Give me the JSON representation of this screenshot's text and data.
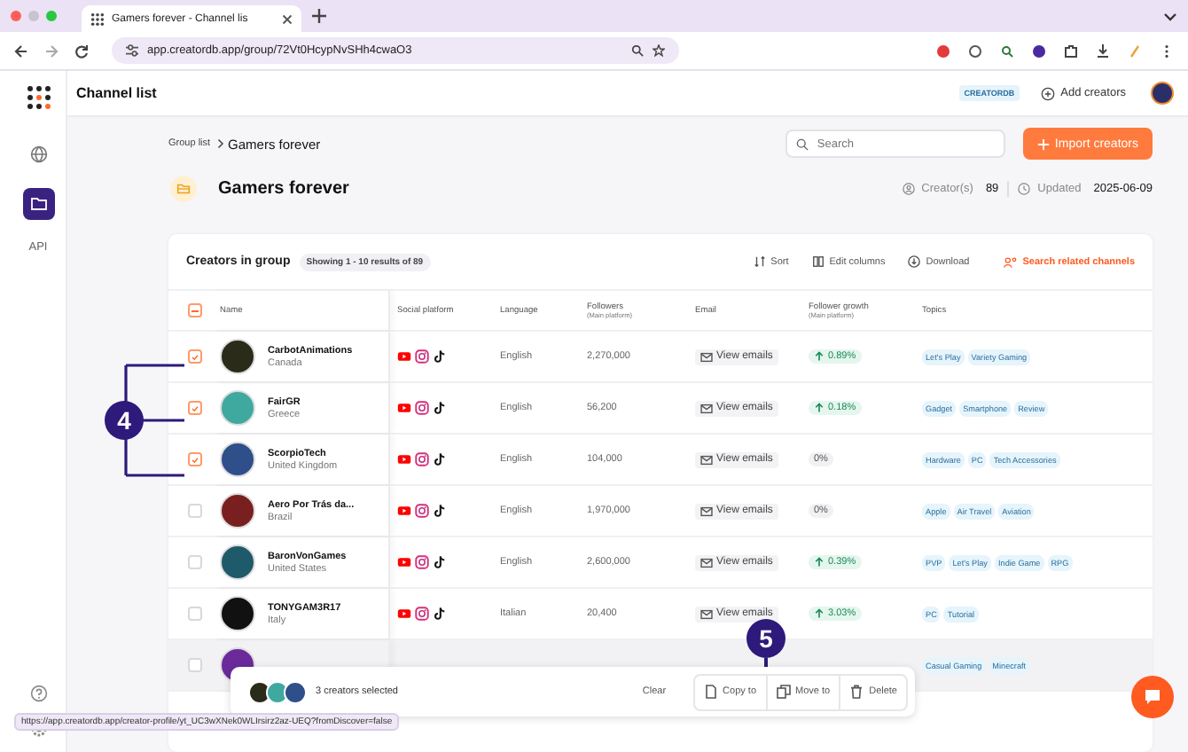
{
  "browser": {
    "tab_title": "Gamers forever - Channel lis",
    "url": "app.creatordb.app/group/72Vt0HcypNvSHh4cwaO3"
  },
  "sidebar": {
    "items": [
      {
        "kind": "globe",
        "selected": false
      },
      {
        "kind": "folder",
        "selected": true
      },
      {
        "kind": "api",
        "label": "API",
        "selected": false
      }
    ]
  },
  "header": {
    "title": "Channel list",
    "brand": "CREATORDB",
    "add_button": "Add creators"
  },
  "breadcrumb": [
    {
      "label": "Group list"
    },
    {
      "label": "Gamers forever"
    }
  ],
  "search": {
    "placeholder": "Search"
  },
  "import_button": "Import creators",
  "group": {
    "title": "Gamers forever",
    "creators_label": "Creator(s)",
    "creators_count": "89",
    "updated_label": "Updated",
    "updated_date": "2025-06-09"
  },
  "table": {
    "title": "Creators in group",
    "showing": "Showing 1 - 10 results of 89",
    "actions": [
      {
        "kind": "sort",
        "label": "Sort"
      },
      {
        "kind": "columns",
        "label": "Edit columns"
      },
      {
        "kind": "download",
        "label": "Download"
      },
      {
        "kind": "related",
        "label": "Search related channels"
      }
    ],
    "select_all_partial": true,
    "columns": [
      {
        "label": "Name"
      },
      {
        "label": "Social platform"
      },
      {
        "label": "Language"
      },
      {
        "label": "Followers",
        "sub": "(Main platform)"
      },
      {
        "label": "Email"
      },
      {
        "label": "Follower growth",
        "sub": "(Main platform)"
      },
      {
        "label": "Topics"
      }
    ],
    "rows": [
      {
        "name": "CarbotAnimations",
        "country": "Canada",
        "checked": true,
        "hovered": false,
        "platforms": [
          {
            "kind": "youtube"
          },
          {
            "kind": "instagram"
          },
          {
            "kind": "tiktok"
          }
        ],
        "language": "English",
        "followers": "2,270,000",
        "email": "View emails",
        "growth": "0.89%",
        "rising": true,
        "topics": [
          "Let's Play",
          "Variety Gaming"
        ]
      },
      {
        "name": "FairGR",
        "country": "Greece",
        "checked": true,
        "hovered": false,
        "platforms": [
          {
            "kind": "youtube"
          },
          {
            "kind": "instagram"
          },
          {
            "kind": "tiktok"
          }
        ],
        "language": "English",
        "followers": "56,200",
        "email": "View emails",
        "growth": "0.18%",
        "rising": true,
        "topics": [
          "Gadget",
          "Smartphone",
          "Review"
        ]
      },
      {
        "name": "ScorpioTech",
        "country": "United Kingdom",
        "checked": true,
        "hovered": false,
        "platforms": [
          {
            "kind": "youtube"
          },
          {
            "kind": "instagram"
          },
          {
            "kind": "tiktok"
          }
        ],
        "language": "English",
        "followers": "104,000",
        "email": "View emails",
        "growth": "0%",
        "rising": false,
        "topics": [
          "Hardware",
          "PC",
          "Tech Accessories"
        ]
      },
      {
        "name": "Aero Por Trás da...",
        "country": "Brazil",
        "checked": false,
        "hovered": false,
        "platforms": [
          {
            "kind": "youtube"
          },
          {
            "kind": "instagram"
          },
          {
            "kind": "tiktok"
          }
        ],
        "language": "English",
        "followers": "1,970,000",
        "email": "View emails",
        "growth": "0%",
        "rising": false,
        "topics": [
          "Apple",
          "Air Travel",
          "Aviation"
        ]
      },
      {
        "name": "BaronVonGames",
        "country": "United States",
        "checked": false,
        "hovered": false,
        "platforms": [
          {
            "kind": "youtube"
          },
          {
            "kind": "instagram"
          },
          {
            "kind": "tiktok"
          }
        ],
        "language": "English",
        "followers": "2,600,000",
        "email": "View emails",
        "growth": "0.39%",
        "rising": true,
        "topics": [
          "PVP",
          "Let's Play",
          "Indie Game",
          "RPG"
        ]
      },
      {
        "name": "TONYGAM3R17",
        "country": "Italy",
        "checked": false,
        "hovered": false,
        "platforms": [
          {
            "kind": "youtube"
          },
          {
            "kind": "instagram"
          },
          {
            "kind": "tiktok"
          }
        ],
        "language": "Italian",
        "followers": "20,400",
        "email": "View emails",
        "growth": "3.03%",
        "rising": true,
        "topics": [
          "PC",
          "Tutorial"
        ]
      },
      {
        "checked": false,
        "hovered": true,
        "topics": [
          "Casual Gaming",
          "Minecraft"
        ]
      }
    ]
  },
  "selection_bar": {
    "count_text": "3 creators selected",
    "clear": "Clear",
    "actions": [
      {
        "kind": "copy",
        "label": "Copy to"
      },
      {
        "kind": "move",
        "label": "Move to"
      },
      {
        "kind": "delete",
        "label": "Delete"
      }
    ]
  },
  "status_url": "https://app.creatordb.app/creator-profile/yt_UC3wXNek0WLIrsirz2az-UEQ?fromDiscover=false",
  "callouts": [
    {
      "label": "4"
    },
    {
      "label": "5"
    }
  ]
}
